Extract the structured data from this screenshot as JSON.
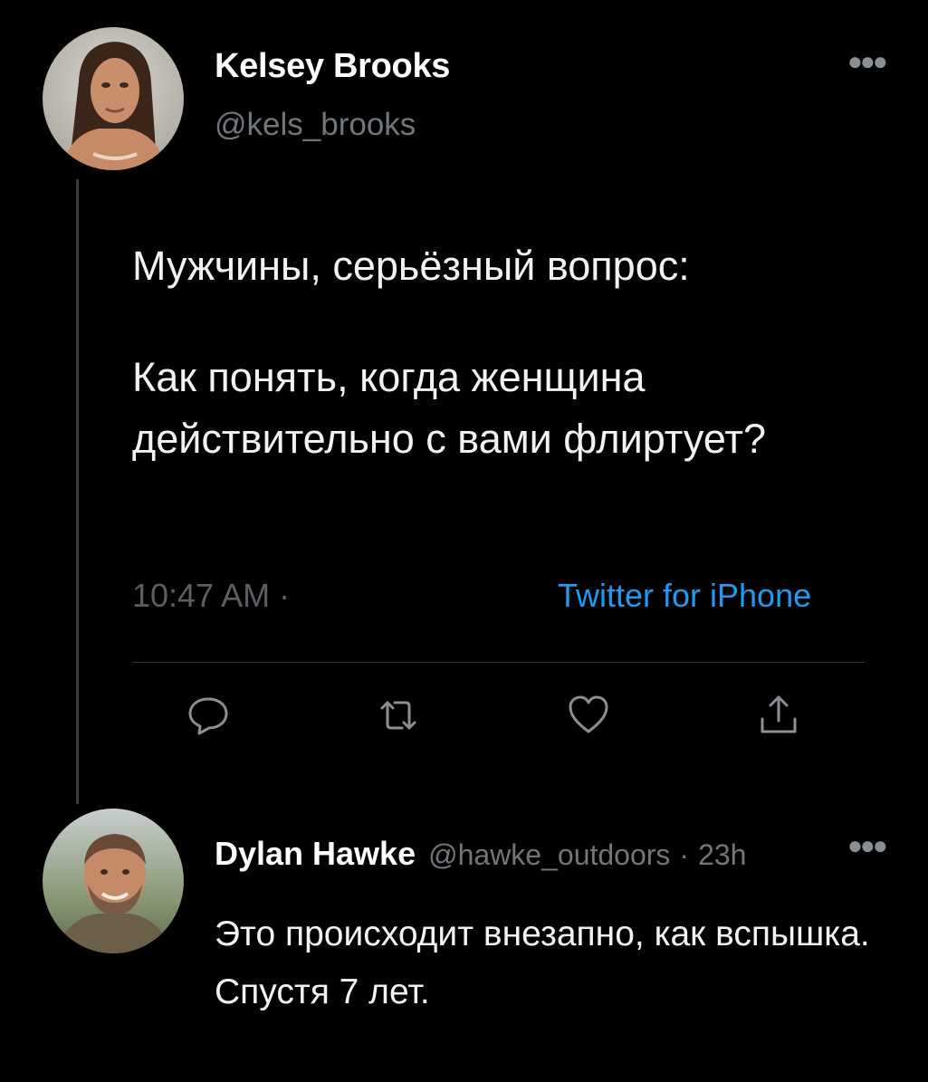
{
  "tweet": {
    "author": {
      "name": "Kelsey Brooks",
      "handle": "@kels_brooks"
    },
    "more_icon": "more-horizontal-icon",
    "text_line_1": "Мужчины, серьёзный вопрос:",
    "text_para_2": "Как понять, когда женщина действительно с вами флиртует?",
    "time": "10:47 AM ·",
    "source": "Twitter for iPhone",
    "actions": [
      {
        "name": "reply",
        "icon": "comment-icon"
      },
      {
        "name": "retweet",
        "icon": "retweet-icon"
      },
      {
        "name": "like",
        "icon": "heart-icon"
      },
      {
        "name": "share",
        "icon": "share-icon"
      }
    ]
  },
  "reply": {
    "author": {
      "name": "Dylan Hawke",
      "handle": "@hawke_outdoors"
    },
    "separator": "·",
    "time": "23h",
    "more_icon": "more-horizontal-icon",
    "text": "Это происходит внезапно, как вспышка. Спустя 7 лет."
  },
  "colors": {
    "background": "#000000",
    "text_primary": "#f2f2f2",
    "text_secondary": "#71767b",
    "accent": "#1d9bf0",
    "divider": "#2f3336"
  }
}
